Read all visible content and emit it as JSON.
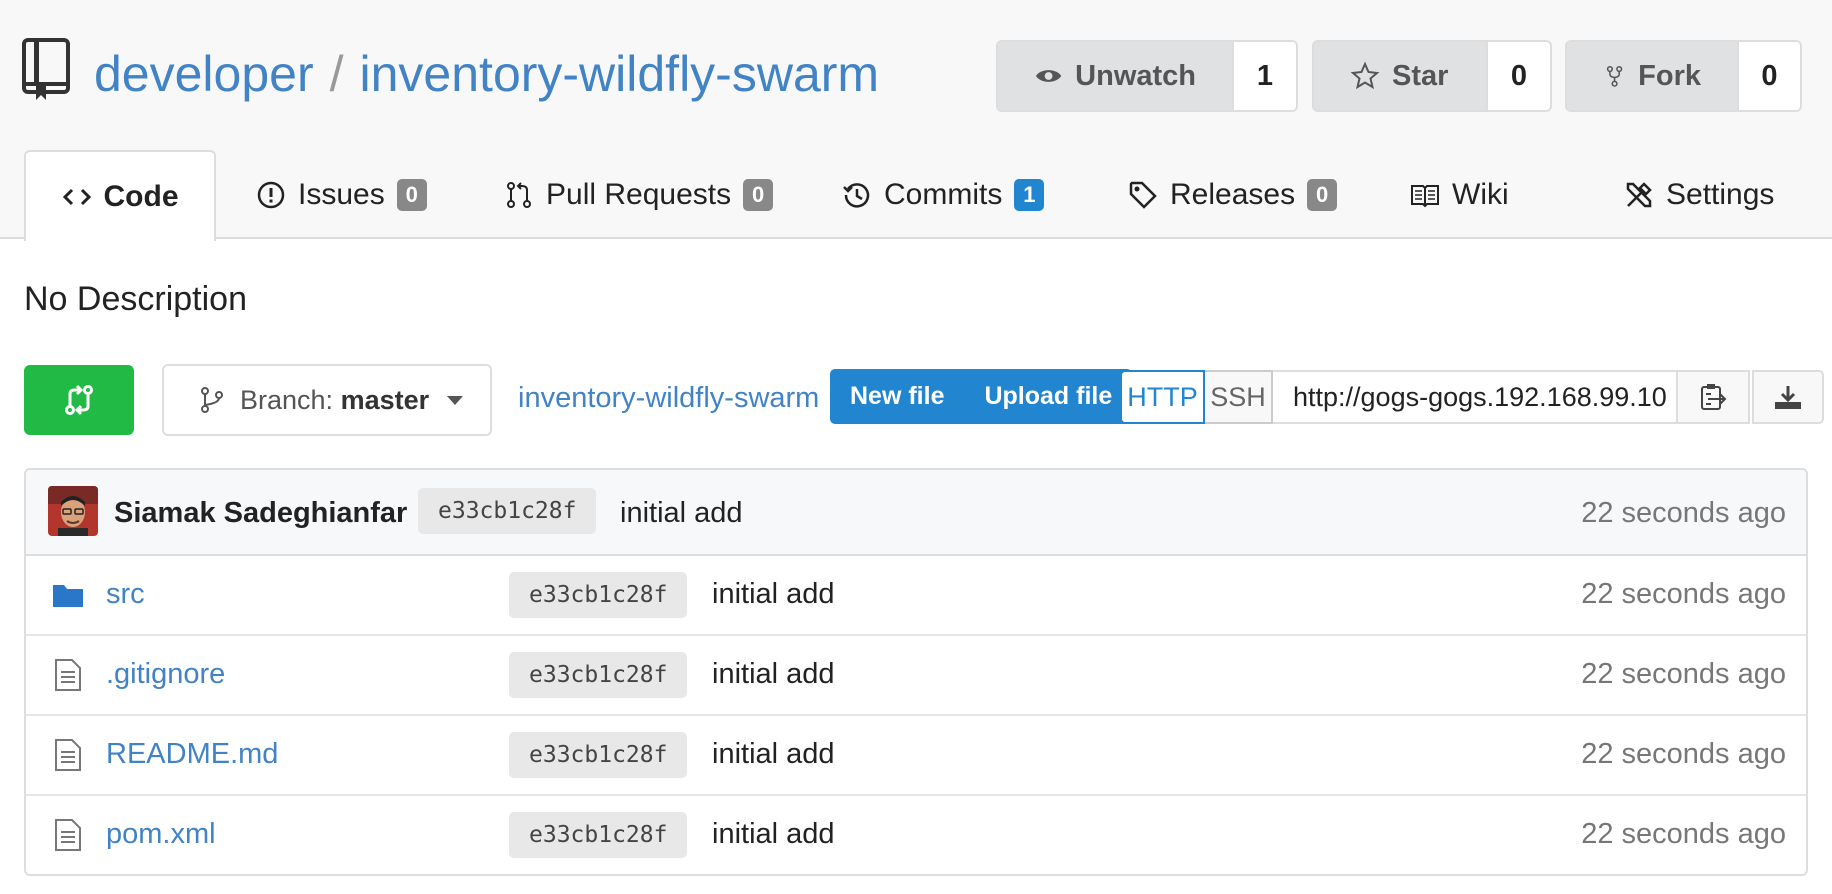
{
  "repo": {
    "owner": "developer",
    "separator": "/",
    "name": "inventory-wildfly-swarm",
    "description": "No Description"
  },
  "actions": {
    "watch": {
      "label": "Unwatch",
      "count": "1",
      "icon": "eye-icon"
    },
    "star": {
      "label": "Star",
      "count": "0",
      "icon": "star-icon"
    },
    "fork": {
      "label": "Fork",
      "count": "0",
      "icon": "fork-icon"
    }
  },
  "tabs": [
    {
      "label": "Code",
      "icon": "code-icon",
      "active": true
    },
    {
      "label": "Issues",
      "badge": "0",
      "icon": "issue-icon"
    },
    {
      "label": "Pull Requests",
      "badge": "0",
      "icon": "pull-request-icon"
    },
    {
      "label": "Commits",
      "badge": "1",
      "icon": "history-icon",
      "badge_color": "#2185d0"
    },
    {
      "label": "Releases",
      "badge": "0",
      "icon": "tag-icon"
    },
    {
      "label": "Wiki",
      "icon": "book-icon"
    },
    {
      "label": "Settings",
      "icon": "tools-icon"
    }
  ],
  "toolbar": {
    "branch_prefix": "Branch:",
    "branch": "master",
    "breadcrumb": "inventory-wildfly-swarm",
    "new_file": "New file",
    "upload_file": "Upload file",
    "http": "HTTP",
    "ssh": "SSH",
    "clone_url": "http://gogs-gogs.192.168.99.10"
  },
  "latest_commit": {
    "author": "Siamak Sadeghianfar",
    "sha": "e33cb1c28f",
    "message": "initial add",
    "time": "22 seconds ago"
  },
  "files": [
    {
      "name": "src",
      "type": "folder",
      "sha": "e33cb1c28f",
      "message": "initial add",
      "time": "22 seconds ago"
    },
    {
      "name": ".gitignore",
      "type": "file",
      "sha": "e33cb1c28f",
      "message": "initial add",
      "time": "22 seconds ago"
    },
    {
      "name": "README.md",
      "type": "file",
      "sha": "e33cb1c28f",
      "message": "initial add",
      "time": "22 seconds ago"
    },
    {
      "name": "pom.xml",
      "type": "file",
      "sha": "e33cb1c28f",
      "message": "initial add",
      "time": "22 seconds ago"
    }
  ],
  "colors": {
    "link": "#4183c4",
    "primary": "#2185d0",
    "green": "#21ba45",
    "badge_gray": "#888888"
  }
}
